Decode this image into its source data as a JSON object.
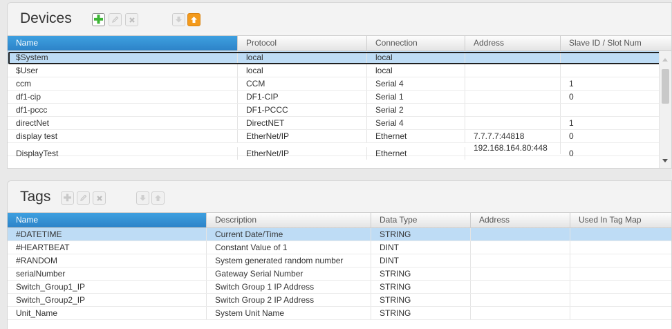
{
  "devices": {
    "title": "Devices",
    "columns": [
      "Name",
      "Protocol",
      "Connection",
      "Address",
      "Slave ID / Slot Num"
    ],
    "rows": [
      [
        "$System",
        "local",
        "local",
        "",
        ""
      ],
      [
        "$User",
        "local",
        "local",
        "",
        ""
      ],
      [
        "ccm",
        "CCM",
        "Serial 4",
        "",
        "1"
      ],
      [
        "df1-cip",
        "DF1-CIP",
        "Serial 1",
        "",
        "0"
      ],
      [
        "df1-pccc",
        "DF1-PCCC",
        "Serial 2",
        "",
        ""
      ],
      [
        "directNet",
        "DirectNET",
        "Serial 4",
        "",
        "1"
      ],
      [
        "display test",
        "EtherNet/IP",
        "Ethernet",
        "7.7.7.7:44818",
        "0"
      ],
      [
        "DisplayTest",
        "EtherNet/IP",
        "Ethernet",
        "192.168.164.80:448",
        "0"
      ]
    ]
  },
  "tags": {
    "title": "Tags",
    "columns": [
      "Name",
      "Description",
      "Data Type",
      "Address",
      "Used In Tag Map"
    ],
    "rows": [
      [
        "#DATETIME",
        "Current Date/Time",
        "STRING",
        "",
        ""
      ],
      [
        "#HEARTBEAT",
        "Constant Value of 1",
        "DINT",
        "",
        ""
      ],
      [
        "#RANDOM",
        "System generated random number",
        "DINT",
        "",
        ""
      ],
      [
        "serialNumber",
        "Gateway Serial Number",
        "STRING",
        "",
        ""
      ],
      [
        "Switch_Group1_IP",
        "Switch Group 1 IP Address",
        "STRING",
        "",
        ""
      ],
      [
        "Switch_Group2_IP",
        "Switch Group 2 IP Address",
        "STRING",
        "",
        ""
      ],
      [
        "Unit_Name",
        "System Unit Name",
        "STRING",
        "",
        ""
      ]
    ]
  },
  "icons": {
    "add": "plus-icon",
    "edit": "pencil-icon",
    "delete": "x-icon",
    "move_down": "arrow-down-icon",
    "move_up": "arrow-up-icon",
    "scroll_up": "scroll-up-arrow",
    "scroll_down": "scroll-down-arrow"
  },
  "colors": {
    "selected_header": "#2d83c8",
    "selected_row": "#bedcf5",
    "add_icon": "#3db535",
    "move_up_button": "#f39a1c"
  }
}
